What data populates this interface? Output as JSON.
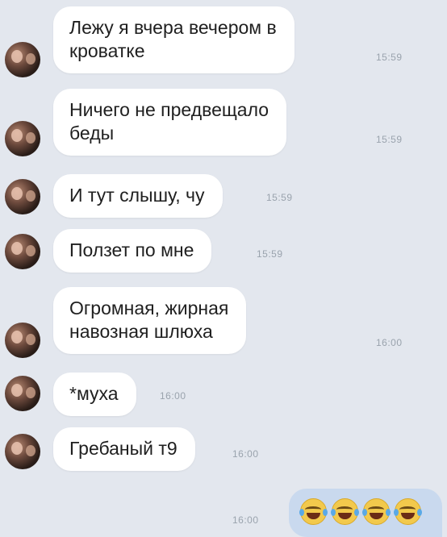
{
  "messages": [
    {
      "text": "Лежу я вчера вечером в\nкроватке",
      "time": "15:59"
    },
    {
      "text": "Ничего не предвещало\nбеды",
      "time": "15:59"
    },
    {
      "text": "И тут слышу, чу",
      "time": "15:59"
    },
    {
      "text": "Ползет по мне",
      "time": "15:59"
    },
    {
      "text": "Огромная, жирная\nнавозная шлюха",
      "time": "16:00"
    },
    {
      "text": "*муха",
      "time": "16:00"
    },
    {
      "text": "Гребаный т9",
      "time": "16:00"
    }
  ],
  "outgoing": {
    "time": "16:00",
    "emoji": [
      "face-with-tears-of-joy",
      "face-with-tears-of-joy",
      "face-with-tears-of-joy",
      "face-with-tears-of-joy"
    ]
  }
}
